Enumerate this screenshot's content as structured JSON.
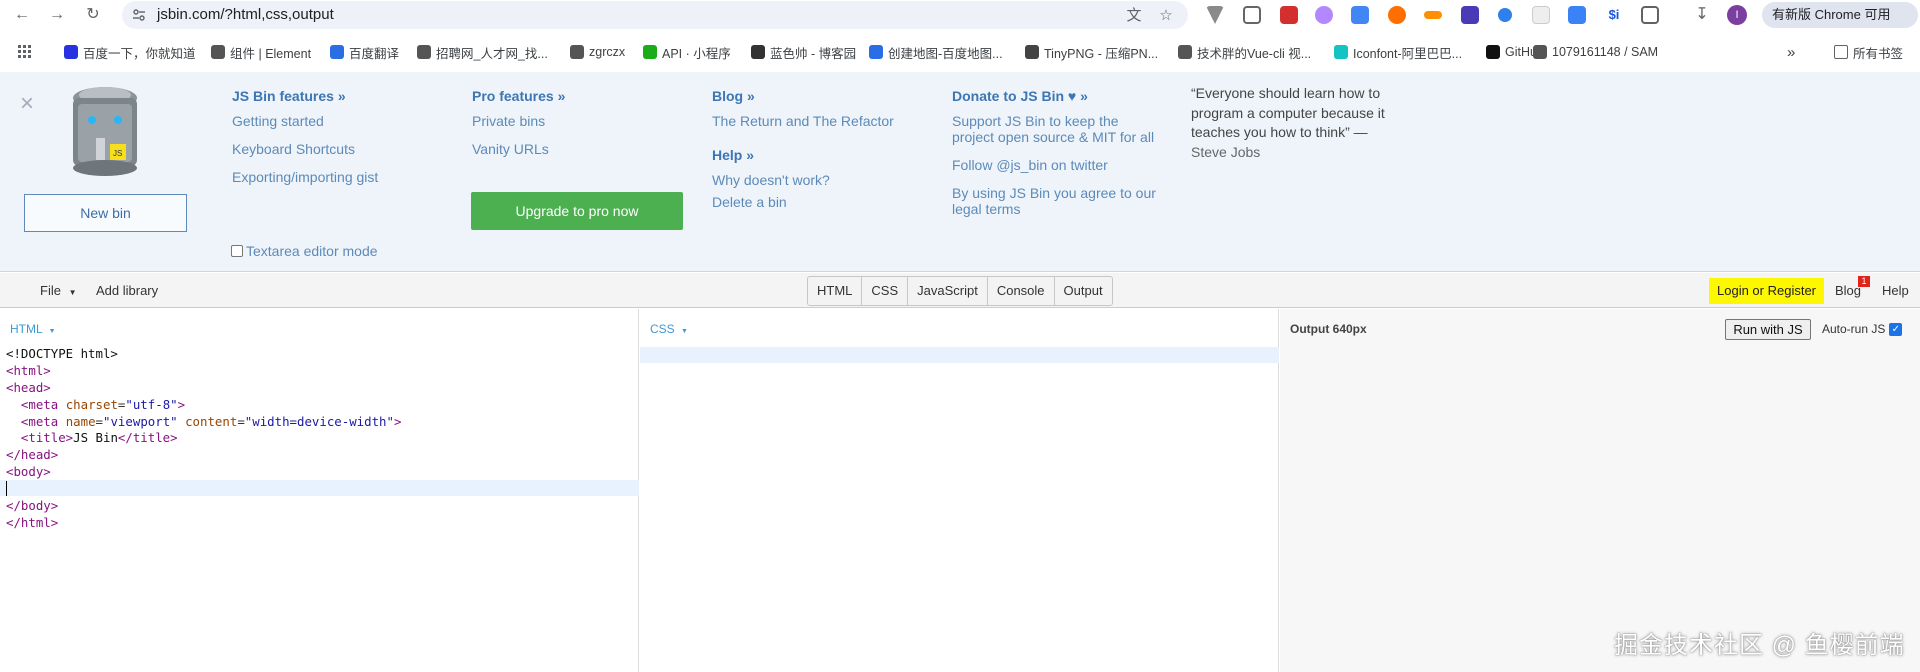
{
  "browser": {
    "url": "jsbin.com/?html,css,output",
    "update_button": "有新版 Chrome 可用",
    "profile_initial": "I",
    "bookmarks": [
      {
        "label": "百度一下，你就知道",
        "color": "#2932e1"
      },
      {
        "label": "组件 | Element",
        "color": "#555555"
      },
      {
        "label": "百度翻译",
        "color": "#2b6de5"
      },
      {
        "label": "招聘网_人才网_找...",
        "color": "#555555"
      },
      {
        "label": "zgrczx",
        "color": "#555555"
      },
      {
        "label": "API · 小程序",
        "color": "#1aad19"
      },
      {
        "label": "蓝色帅 - 博客园",
        "color": "#333333"
      },
      {
        "label": "创建地图-百度地图...",
        "color": "#2b6de5"
      },
      {
        "label": "TinyPNG - 压缩PN...",
        "color": "#444444"
      },
      {
        "label": "技术胖的Vue-cli 视...",
        "color": "#555555"
      },
      {
        "label": "Iconfont-阿里巴巴...",
        "color": "#14c3c3"
      },
      {
        "label": "GitHub",
        "color": "#111111"
      },
      {
        "label": "1079161148 / SAM",
        "color": "#555555"
      }
    ],
    "all_bookmarks": "所有书签"
  },
  "promo": {
    "new_bin": "New bin",
    "features": {
      "head": "JS Bin features »",
      "links": [
        "Getting started",
        "Keyboard Shortcuts",
        "Exporting/importing gist"
      ]
    },
    "pro": {
      "head": "Pro features »",
      "links": [
        "Private bins",
        "Vanity URLs"
      ],
      "upgrade": "Upgrade to pro now"
    },
    "blog": {
      "head": "Blog »",
      "links": [
        "The Return and The Refactor"
      ]
    },
    "help": {
      "head": "Help »",
      "links": [
        "Why doesn't work?",
        "Delete a bin"
      ]
    },
    "donate": {
      "head": "Donate to JS Bin ♥ »",
      "links": [
        "Support JS Bin to keep the project open source & MIT for all",
        "Follow @js_bin on twitter",
        "By using JS Bin you agree to our legal terms"
      ]
    },
    "textarea_mode": "Textarea editor mode",
    "quote": "“Everyone should learn how to program a computer because it teaches you how to think” —",
    "quote_author": "Steve Jobs"
  },
  "toolbar": {
    "file": "File",
    "add_library": "Add library",
    "tabs": [
      "HTML",
      "CSS",
      "JavaScript",
      "Console",
      "Output"
    ],
    "login": "Login or Register",
    "blog": "Blog",
    "blog_badge": "1",
    "help": "Help"
  },
  "panels": {
    "html_label": "HTML",
    "css_label": "CSS",
    "output_label": "Output 640px",
    "run_button": "Run with JS",
    "autorun_label": "Auto-run JS",
    "autorun_checked": true
  },
  "watermark": "掘金技术社区 @ 鱼樱前端"
}
